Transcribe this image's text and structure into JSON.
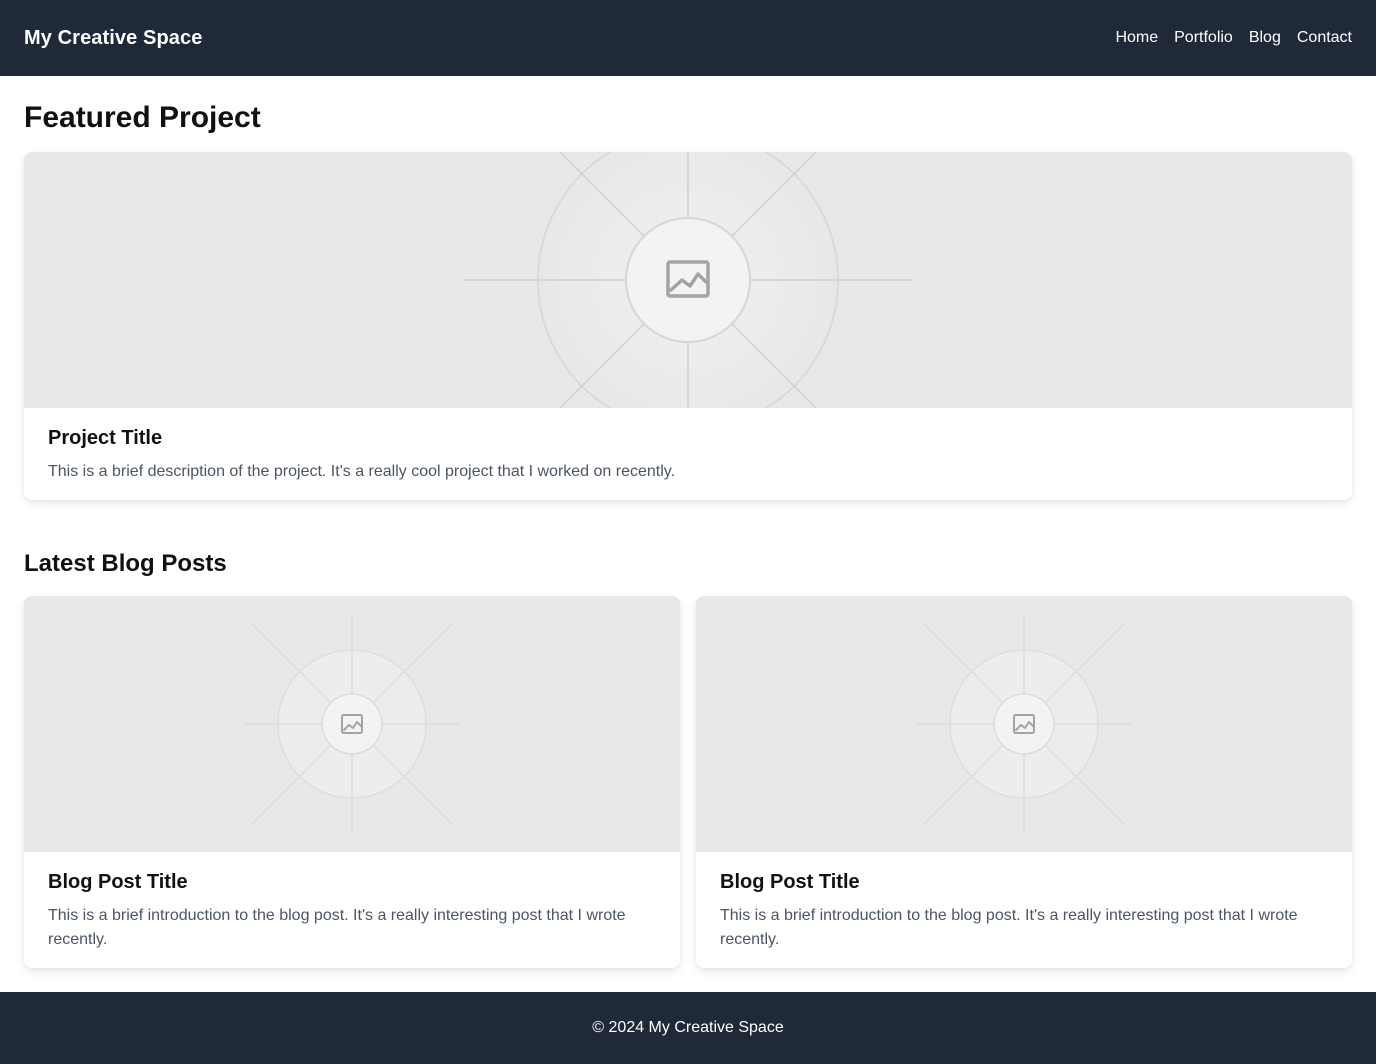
{
  "header": {
    "brand": "My Creative Space",
    "nav": [
      {
        "label": "Home"
      },
      {
        "label": "Portfolio"
      },
      {
        "label": "Blog"
      },
      {
        "label": "Contact"
      }
    ]
  },
  "featured": {
    "heading": "Featured Project",
    "card": {
      "image_icon": "image-icon",
      "title": "Project Title",
      "description": "This is a brief description of the project. It's a really cool project that I worked on recently."
    }
  },
  "blog": {
    "heading": "Latest Blog Posts",
    "posts": [
      {
        "image_icon": "image-icon",
        "title": "Blog Post Title",
        "description": "This is a brief introduction to the blog post. It's a really interesting post that I wrote recently."
      },
      {
        "image_icon": "image-icon",
        "title": "Blog Post Title",
        "description": "This is a brief introduction to the blog post. It's a really interesting post that I wrote recently."
      }
    ]
  },
  "footer": {
    "copyright": "© 2024 My Creative Space"
  },
  "colors": {
    "header_bg": "#1f2937",
    "footer_bg": "#1f2937",
    "placeholder_bg": "#e8e8e8",
    "text_primary": "#111111",
    "text_secondary": "#4b5563"
  }
}
